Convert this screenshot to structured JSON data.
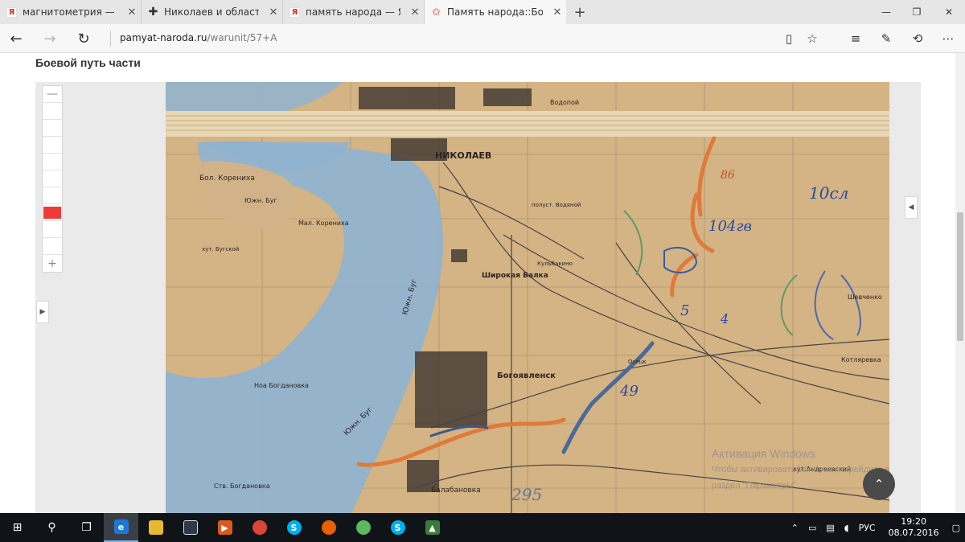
{
  "browser": {
    "tabs": [
      {
        "favicon": "yandex-icon",
        "title": "магнитометрия — Яндекс:"
      },
      {
        "favicon": "iron-cross-icon",
        "title": "Николаев и область. | Стра"
      },
      {
        "favicon": "yandex-icon",
        "title": "память народа — Яндекс: н"
      },
      {
        "favicon": "star-icon",
        "title": "Память народа::Боевой"
      }
    ],
    "address": {
      "host": "pamyat-naroda.ru",
      "path": "/warunit/57+A"
    }
  },
  "page": {
    "heading": "Боевой путь части"
  },
  "map": {
    "zoom_in": "+",
    "zoom_out": "—",
    "labels": {
      "nikolaev": "НИКОЛАЕВ",
      "bol_korenikha": "Бол. Корениха",
      "mal_korenikha": "Мал. Корениха",
      "yuzhn_bug_1": "Южн. Буг",
      "yuzhn_bug_2": "Южн. Буг",
      "yuzhn_bug_3": "Южн. Буг",
      "shirokaya_balka": "Широкая Балка",
      "bogoyavlensk": "Богоявленск",
      "noa_bogdanovka": "Ноа Богдановка",
      "balabanovka": "Балабановка",
      "vodopoy": "Водопой",
      "kulbakino": "Кульбакино",
      "shevchenko": "Шевченко",
      "kotlyarevka": "Котляревка",
      "khut_andreevsky": "хут.Андреевский",
      "stv_bogdanovka": "Ств. Богдановка",
      "khut_bugskoy": "хут. Бугской",
      "osetsk": "Осецк",
      "vodyanoy": "Водяной",
      "poluost": "полуст. Водяной"
    },
    "annotations": {
      "a1": "10сл",
      "a2": "86",
      "a3": "104гв",
      "a4": "5",
      "a5": "49",
      "a6": "295",
      "a7": "4"
    }
  },
  "watermark": {
    "line1": "Активация Windows",
    "line2": "Чтобы активировать Windows, перейдите в",
    "line3": "раздел \"Параметры\"."
  },
  "taskbar": {
    "language": "РУС",
    "time": "19:20",
    "date": "08.07.2016"
  },
  "colors": {
    "accent": "#0078d7",
    "zoom_marker": "#ef3a3a",
    "map_paper": "#d8b98a",
    "river": "#8fb3d0"
  }
}
